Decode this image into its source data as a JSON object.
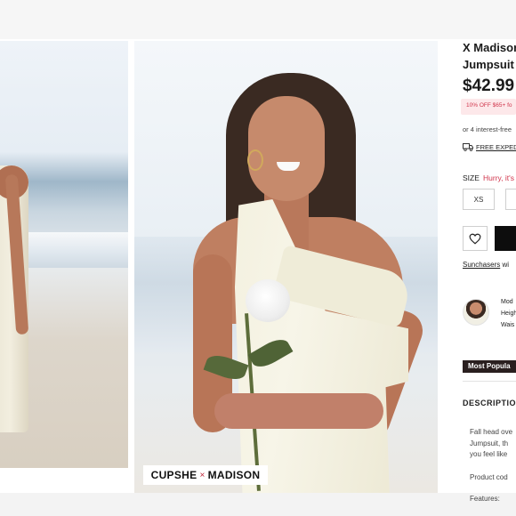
{
  "gallery": {
    "brand_left": "CUPSHE",
    "brand_sep": "×",
    "brand_right": "MADISON"
  },
  "product": {
    "title_line1": "X Madison",
    "title_line2": "Jumpsuit",
    "price": "$42.99",
    "promo": "10% OFF $65+ fo",
    "installments": "or 4 interest-free",
    "shipping": "FREE EXPED",
    "size_label": "SIZE",
    "size_note": "Hurry, it's",
    "sizes": [
      "XS"
    ],
    "sunchasers_link": "Sunchasers",
    "sunchasers_rest": " wi",
    "model_info": [
      "Mod",
      "Heigh",
      "Wais"
    ],
    "popular_badge": "Most Popula",
    "description_heading": "DESCRIPTIO",
    "description_lines": [
      "Fall head ove",
      "Jumpsuit, th",
      "you feel like"
    ],
    "product_code": "Product cod",
    "features": "Features:"
  },
  "colors": {
    "accent_red": "#d0344b",
    "promo_bg": "#fde8ea",
    "button_black": "#0d0d0d",
    "badge_dark": "#2a1f1f"
  },
  "icons": [
    "heart-icon",
    "truck-icon"
  ]
}
